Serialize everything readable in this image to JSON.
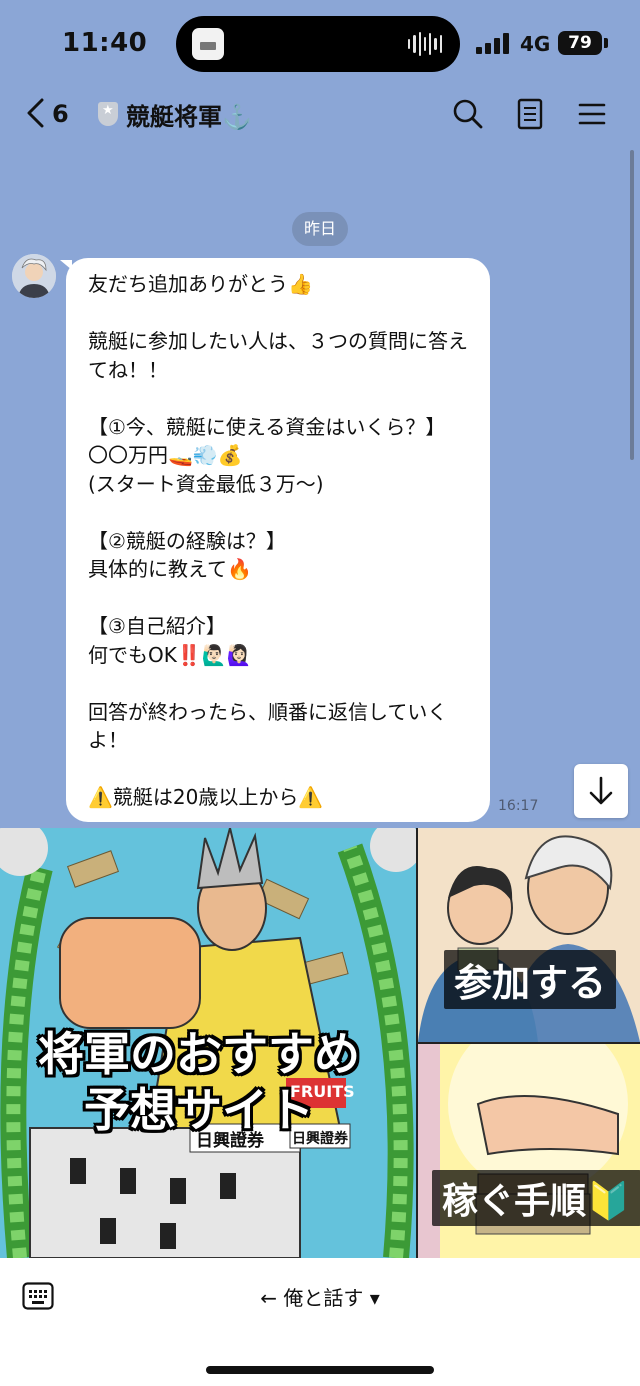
{
  "status_bar": {
    "time": "11:40",
    "network": "4G",
    "battery": "79"
  },
  "header": {
    "back_count": "6",
    "title": "競艇将軍⚓️",
    "icons": [
      "back-chevron-icon",
      "shield-icon",
      "search-icon",
      "notes-icon",
      "menu-icon"
    ]
  },
  "chat": {
    "date_label": "昨日",
    "message": {
      "text": "友だち追加ありがとう👍\n\n競艇に参加したい人は、３つの質問に答えてね！！\n\n【①今、競艇に使える資金はいくら？】\n〇〇万円🚤💨💰\n(スタート資金最低３万〜)\n\n【②競艇の経験は？】\n具体的に教えて🔥\n\n【③自己紹介】\n何でもOK‼️🙋🏻‍♂️🙋🏻‍♀️\n\n回答が終わったら、順番に返信していくよ！\n\n⚠️競艇は20歳以上から⚠️",
      "time": "16:17"
    }
  },
  "rich_menu": {
    "main_label": "将軍のおすすめ\n予想サイト",
    "join_label": "参加する",
    "earn_label": "稼ぐ手順🔰",
    "main_signs": [
      "日興證券",
      "日興證券",
      "FRUITS"
    ]
  },
  "bottom_bar": {
    "menu_toggle": "← 俺と話す ▾"
  },
  "colors": {
    "chat_background": "#8ba6d6",
    "bubble": "#ffffff",
    "menu_main": "#64c2dc"
  }
}
